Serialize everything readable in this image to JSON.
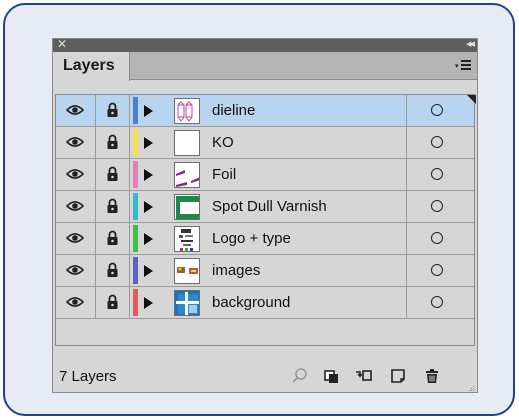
{
  "panel": {
    "tab_label": "Layers",
    "footer_count": "7 Layers"
  },
  "layers": [
    {
      "name": "dieline",
      "color": "#4a7fd6",
      "selected": true,
      "thumb": "dieline"
    },
    {
      "name": "KO",
      "color": "#f4e04d",
      "selected": false,
      "thumb": "blank"
    },
    {
      "name": "Foil",
      "color": "#e07fb8",
      "selected": false,
      "thumb": "foil"
    },
    {
      "name": "Spot Dull Varnish",
      "color": "#36b9cf",
      "selected": false,
      "thumb": "varnish"
    },
    {
      "name": "Logo + type",
      "color": "#3fbf4a",
      "selected": false,
      "thumb": "logo"
    },
    {
      "name": "images",
      "color": "#5b63c4",
      "selected": false,
      "thumb": "images"
    },
    {
      "name": "background",
      "color": "#e25b5b",
      "selected": false,
      "thumb": "background"
    }
  ],
  "icons": {
    "eye": "eye-icon",
    "lock": "lock-icon",
    "expand": "disclosure-triangle-icon",
    "target": "target-circle-icon",
    "search": "search-icon",
    "collect": "collect-for-export-icon",
    "sublayer": "new-sublayer-icon",
    "new_layer": "new-layer-icon",
    "delete": "trash-icon"
  }
}
